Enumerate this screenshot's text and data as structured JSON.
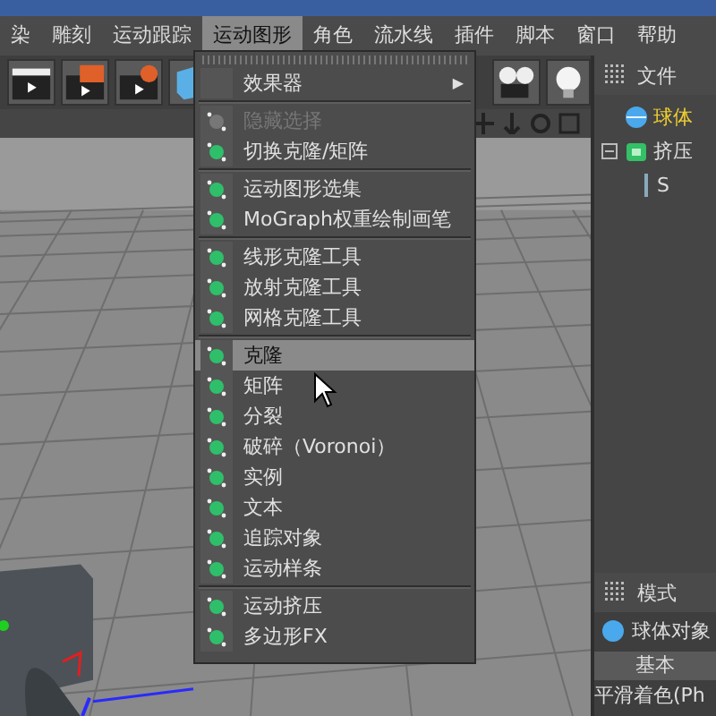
{
  "menubar": [
    {
      "label": "染",
      "selected": false
    },
    {
      "label": "雕刻",
      "selected": false
    },
    {
      "label": "运动跟踪",
      "selected": false
    },
    {
      "label": "运动图形",
      "selected": true
    },
    {
      "label": "角色",
      "selected": false
    },
    {
      "label": "流水线",
      "selected": false
    },
    {
      "label": "插件",
      "selected": false
    },
    {
      "label": "脚本",
      "selected": false
    },
    {
      "label": "窗口",
      "selected": false
    },
    {
      "label": "帮助",
      "selected": false
    }
  ],
  "menu": [
    {
      "kind": "submenu",
      "label": "效果器",
      "arrow": "▶",
      "disabled": false,
      "selected": false
    },
    {
      "kind": "separator"
    },
    {
      "kind": "item",
      "label": "隐藏选择",
      "disabled": true,
      "selected": false
    },
    {
      "kind": "item",
      "label": "切换克隆/矩阵",
      "disabled": false,
      "selected": false
    },
    {
      "kind": "separator"
    },
    {
      "kind": "item",
      "label": "运动图形选集",
      "disabled": false,
      "selected": false
    },
    {
      "kind": "item",
      "label": "MoGraph权重绘制画笔",
      "disabled": false,
      "selected": false
    },
    {
      "kind": "separator"
    },
    {
      "kind": "item",
      "label": "线形克隆工具",
      "disabled": false,
      "selected": false
    },
    {
      "kind": "item",
      "label": "放射克隆工具",
      "disabled": false,
      "selected": false
    },
    {
      "kind": "item",
      "label": "网格克隆工具",
      "disabled": false,
      "selected": false
    },
    {
      "kind": "separator"
    },
    {
      "kind": "item",
      "label": "克隆",
      "disabled": false,
      "selected": true
    },
    {
      "kind": "item",
      "label": "矩阵",
      "disabled": false,
      "selected": false
    },
    {
      "kind": "item",
      "label": "分裂",
      "disabled": false,
      "selected": false
    },
    {
      "kind": "item",
      "label": "破碎（Voronoi）",
      "disabled": false,
      "selected": false
    },
    {
      "kind": "item",
      "label": "实例",
      "disabled": false,
      "selected": false
    },
    {
      "kind": "item",
      "label": "文本",
      "disabled": false,
      "selected": false
    },
    {
      "kind": "item",
      "label": "追踪对象",
      "disabled": false,
      "selected": false
    },
    {
      "kind": "item",
      "label": "运动样条",
      "disabled": false,
      "selected": false
    },
    {
      "kind": "separator"
    },
    {
      "kind": "item",
      "label": "运动挤压",
      "disabled": false,
      "selected": false
    },
    {
      "kind": "item",
      "label": "多边形FX",
      "disabled": false,
      "selected": false
    }
  ],
  "object_manager": {
    "tab": "文件",
    "tree": [
      {
        "label": "球体",
        "selected": true
      },
      {
        "label": "挤压",
        "selected": false,
        "expanded": true,
        "children": [
          {
            "label": "S",
            "selected": false
          }
        ]
      }
    ]
  },
  "attribute_manager": {
    "tab": "模式",
    "object": "球体对象",
    "tab_basic": "基本",
    "field": "平滑着色(Ph"
  }
}
